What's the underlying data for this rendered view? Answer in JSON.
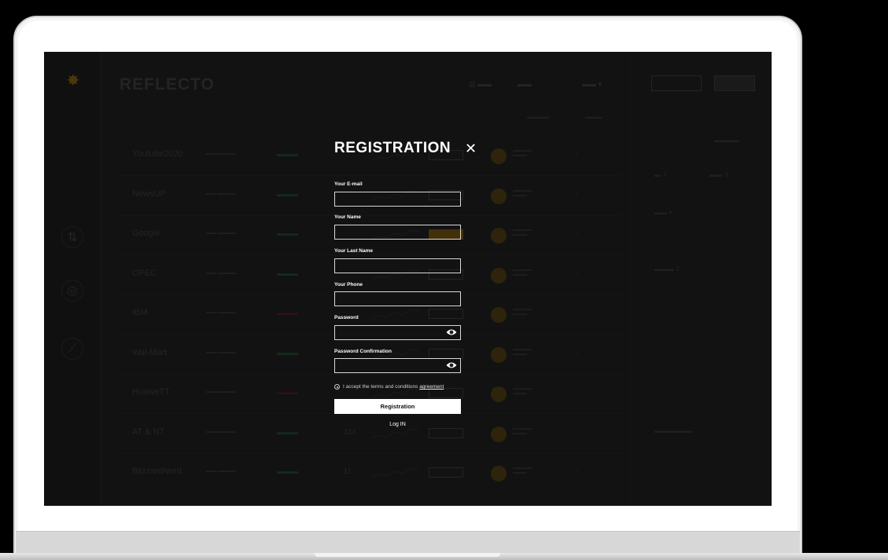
{
  "app": {
    "brand": "REFLECTO"
  },
  "modal": {
    "title": "REGISTRATION",
    "close_symbol": "✕",
    "fields": {
      "email_label": "Your E-mail",
      "name_label": "Your Name",
      "last_name_label": "Your Last Name",
      "phone_label": "Your Phone",
      "password_label": "Password",
      "password_confirm_label": "Password Confirmation"
    },
    "terms_text": "I accept the terms and conditions ",
    "terms_link": "agreement",
    "submit_label": "Registration",
    "login_label": "Log IN"
  },
  "background_rows": [
    {
      "name": "Youtube2020",
      "pct_color": "#1f4a2a"
    },
    {
      "name": "NewsUP",
      "pct_color": "#1f4a2a"
    },
    {
      "name": "Google",
      "pct_color": "#1f4a2a",
      "highlight": true
    },
    {
      "name": "OPEC",
      "pct_color": "#1f4a2a"
    },
    {
      "name": "IBM",
      "pct_color": "#4a1f1f"
    },
    {
      "name": "Wal-Mart",
      "pct_color": "#1f4a2a"
    },
    {
      "name": "HuaweTT",
      "pct_color": "#4a1f1f"
    },
    {
      "name": "AT & NT",
      "pct_color": "#1f4a2a",
      "count": "324"
    },
    {
      "name": "BlizzardNord",
      "pct_color": "#1f4a2a",
      "count": "11"
    }
  ],
  "icons": {
    "logo": "logo-star-icon",
    "eye": "eye-icon",
    "close": "close-icon"
  }
}
